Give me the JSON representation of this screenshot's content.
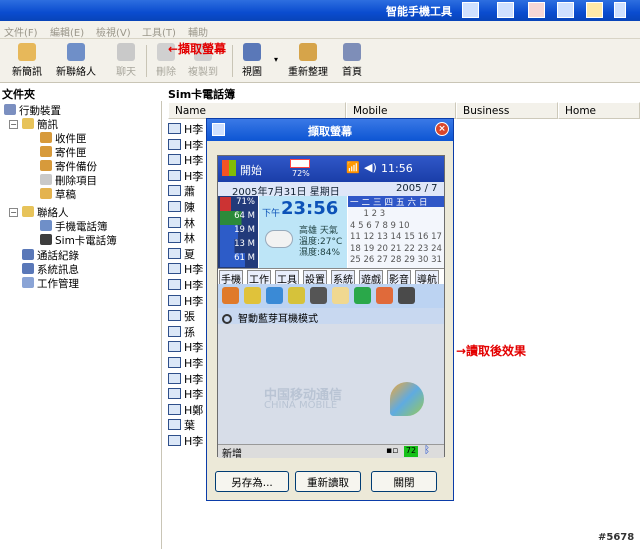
{
  "window": {
    "title": "智能手機工具"
  },
  "menu": [
    "文件(F)",
    "編輯(E)",
    "檢視(V)",
    "工具(T)",
    "輔助"
  ],
  "toolbar": {
    "new_sms": "新簡訊",
    "new_contact": "新聯絡人",
    "chat": "聊天",
    "delete": "刪除",
    "copy_to": "複製到",
    "view": "視圖",
    "refresh": "重新整理",
    "home": "首頁"
  },
  "annotations": {
    "capture": "←擷取螢幕",
    "result": "→讀取後效果",
    "watermark": "#5678"
  },
  "folders": {
    "title": "文件夾",
    "items": [
      "行動裝置",
      "簡訊",
      "收件匣",
      "寄件匣",
      "寄件備份",
      "刪除項目",
      "草稿",
      "聯絡人",
      "手機電話簿",
      "Sim卡電話簿",
      "通話紀錄",
      "系統訊息",
      "工作管理"
    ]
  },
  "list": {
    "title": "Sim卡電話簿",
    "columns": [
      "Name",
      "Mobile",
      "Business",
      "Home"
    ],
    "rows": [
      "H李",
      "H李",
      "H李",
      "H李",
      "蕭",
      "陳",
      "林",
      "林",
      "夏",
      "H李",
      "H李",
      "H李",
      "張",
      "孫",
      "H李",
      "H李",
      "H李",
      "H李",
      "H鄭",
      "葉",
      "H李"
    ]
  },
  "dialog": {
    "title": "擷取螢幕",
    "save_as": "另存為...",
    "reload": "重新讀取",
    "close": "關閉"
  },
  "device": {
    "start": "開始",
    "battery_pct": "72%",
    "clock": "11:56",
    "date": "2005年7月31日 星期日",
    "date_right": "2005 / 7",
    "bars": [
      "71%",
      "64 M",
      "19 M",
      "13 M",
      "61 M"
    ],
    "time_prefix": "下午",
    "time": "23:56",
    "weather": [
      "高雄 天氣",
      "溫度:27°C",
      "濕度:84%"
    ],
    "cal_header": "一二三四五六日",
    "cal_rows": [
      "     1 2 3",
      "4 5 6 7 8 9 10",
      "11 12 13 14 15 16 17",
      "18 19 20 21 22 23 24",
      "25 26 27 28 29 30 31"
    ],
    "tabs": [
      "手機",
      "工作",
      "工具",
      "設置",
      "系統",
      "遊戲",
      "影音",
      "導航"
    ],
    "bt_text": "智動藍芽耳機模式",
    "brand_cn": "中国移动通信",
    "brand_en": "CHINA MOBILE",
    "bottom_left": "新增",
    "level": "72"
  },
  "colors": {
    "accent": "#0a4ccf",
    "annotation": "#e30000"
  }
}
